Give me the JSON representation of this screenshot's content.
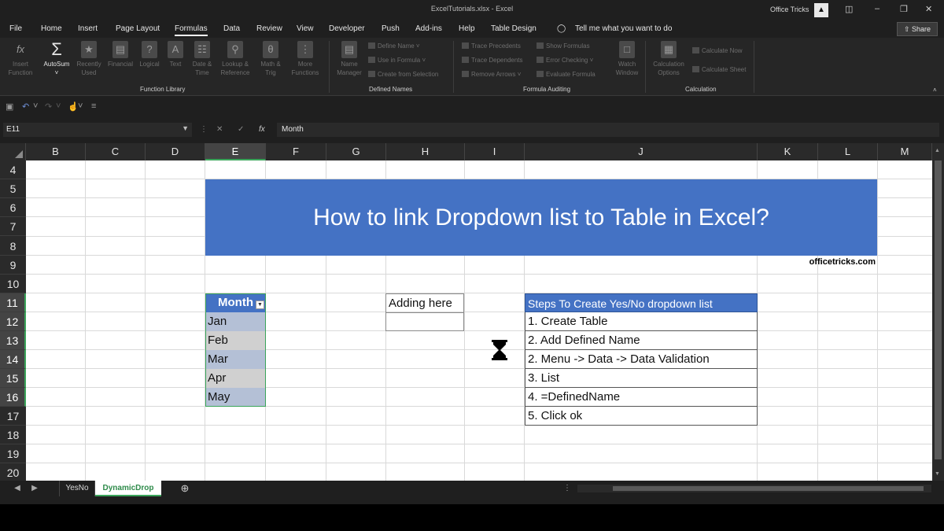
{
  "window": {
    "title": "ExcelTutorials.xlsx  -  Excel",
    "account": "Office Tricks",
    "account_icon": "▲"
  },
  "tabs": [
    "File",
    "Home",
    "Insert",
    "Page Layout",
    "Formulas",
    "Data",
    "Review",
    "View",
    "Developer",
    "Push",
    "Add-ins",
    "Help",
    "Table Design"
  ],
  "active_tab": "Formulas",
  "tell_me": "Tell me what you want to do",
  "share_label": "Share",
  "ribbon": {
    "insert_function": [
      "Insert",
      "Function"
    ],
    "autosum": "AutoSum",
    "recently_used": [
      "Recently",
      "Used"
    ],
    "financial": "Financial",
    "logical": "Logical",
    "text": "Text",
    "date_time": [
      "Date &",
      "Time"
    ],
    "lookup_reference": [
      "Lookup &",
      "Reference"
    ],
    "math_trig": [
      "Math &",
      "Trig"
    ],
    "more_functions": [
      "More",
      "Functions"
    ],
    "name_manager": [
      "Name",
      "Manager"
    ],
    "define_name": "Define Name",
    "use_in_formula": "Use in Formula",
    "create_from_selection": "Create from Selection",
    "trace_precedents": "Trace Precedents",
    "trace_dependents": "Trace Dependents",
    "remove_arrows": "Remove Arrows",
    "show_formulas": "Show Formulas",
    "error_checking": "Error Checking",
    "evaluate_formula": "Evaluate Formula",
    "watch_window": [
      "Watch",
      "Window"
    ],
    "calculation_options": [
      "Calculation",
      "Options"
    ],
    "calculate_now": "Calculate Now",
    "calculate_sheet": "Calculate Sheet",
    "groups": {
      "function_library": "Function Library",
      "defined_names": "Defined Names",
      "formula_auditing": "Formula Auditing",
      "calculation": "Calculation"
    }
  },
  "formula_bar": {
    "name_box": "E11",
    "value": "Month"
  },
  "columns": [
    "B",
    "C",
    "D",
    "E",
    "F",
    "G",
    "H",
    "I",
    "J",
    "K",
    "L",
    "M"
  ],
  "selected_column": "E",
  "rows": [
    "4",
    "5",
    "6",
    "7",
    "8",
    "9",
    "10",
    "11",
    "12",
    "13",
    "14",
    "15",
    "16",
    "17",
    "18",
    "19",
    "20"
  ],
  "selected_rows": [
    "11",
    "12",
    "13",
    "14",
    "15",
    "16"
  ],
  "sheet": {
    "banner": "How to link Dropdown list to Table in Excel?",
    "site": "officetricks.com",
    "month_table": {
      "header": "Month",
      "items": [
        "Jan",
        "Feb",
        "Mar",
        "Apr",
        "May"
      ]
    },
    "adding_here": "Adding here",
    "steps": {
      "header": "Steps To Create Yes/No dropdown list",
      "items": [
        "1. Create Table",
        "2. Add Defined Name",
        "2. Menu -> Data -> Data Validation",
        "3. List",
        "4. =DefinedName",
        "5. Click ok"
      ]
    }
  },
  "sheet_tabs": [
    "YesNo",
    "DynamicDrop"
  ],
  "active_sheet": "DynamicDrop",
  "colors": {
    "banner": "#4472c4",
    "selection": "#3aa45a",
    "active_sheet_text": "#3aa45a"
  }
}
